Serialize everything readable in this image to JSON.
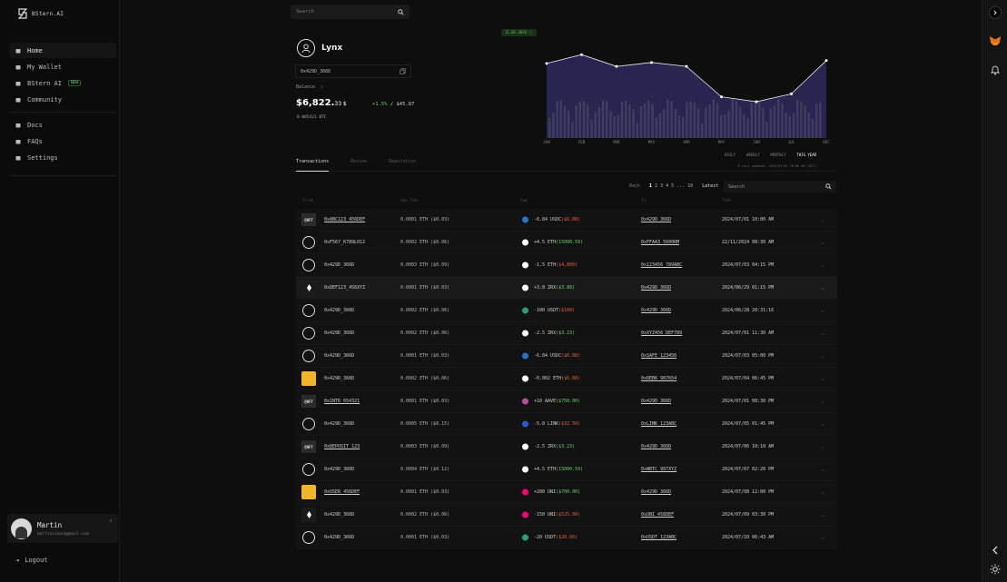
{
  "brand": {
    "name": "BStern.AI"
  },
  "nav": [
    {
      "label": "Home",
      "icon": "home-icon",
      "active": true
    },
    {
      "label": "My Wallet",
      "icon": "wallet-icon"
    },
    {
      "label": "BStern AI",
      "icon": "ai-icon",
      "badge": "NEW"
    },
    {
      "label": "Community",
      "icon": "community-icon"
    }
  ],
  "nav2": [
    {
      "label": "Docs",
      "icon": "folder-icon"
    },
    {
      "label": "FAQs",
      "icon": "faq-icon"
    },
    {
      "label": "Settings",
      "icon": "gear-icon"
    }
  ],
  "user": {
    "name": "Martin",
    "email": "martinsimon@gmail.com"
  },
  "logout": "Logout",
  "search": {
    "placeholder": "Search"
  },
  "profile": {
    "name": "Lynx",
    "address": "0x429D_366D",
    "balance_label": "Balance",
    "balance_main": "$6,822.",
    "balance_cents": "33 $",
    "change_pct": "+1.5%",
    "change_sep": " / ",
    "change_usd": "$45.87",
    "btc": "0.005421 BTC"
  },
  "chart_data": {
    "type": "area",
    "tooltip": "11.01.2024",
    "categories": [
      "JAN",
      "FEB",
      "MAR",
      "MAY",
      "APR",
      "MAY",
      "JUN",
      "JUL",
      "DEC"
    ],
    "values": [
      76,
      85,
      73,
      77,
      73,
      42,
      37,
      45,
      79
    ],
    "ylim": [
      0,
      100
    ],
    "periods": [
      "DAILY",
      "WEEKLY",
      "MONTHLY",
      "THIS YEAR"
    ],
    "active_period": "THIS YEAR",
    "last_update": "Last updated: 2024/07/01 10:00 AM (UTC)"
  },
  "tabs": [
    "Transactions",
    "Review",
    "Reputation"
  ],
  "pager": {
    "back": "Back",
    "p1": "1",
    "rest": "2 3 4 5 ... 10",
    "latest": "Latest"
  },
  "table_search": {
    "placeholder": "Search"
  },
  "columns": {
    "from": "From",
    "fee": "Gas Fee",
    "sum": "Sum",
    "to": "To",
    "time": "Time"
  },
  "transactions": [
    {
      "icon": "nft",
      "iconText": "@NFT",
      "from": "0xABC123_456DEF",
      "fromUnderline": true,
      "fee": "0.0001 ETH ($0.03)",
      "coin": "#2775ca",
      "amt": "-6.84 USDC",
      "amtVal": "($6.88)",
      "sign": "neg",
      "to": "0x429D_366D",
      "time": "2024/07/01 10:00 AM"
    },
    {
      "icon": "user",
      "from": "0xF567_K789L012",
      "fee": "0.0002 ETH ($0.06)",
      "coin": "#ffffff",
      "amt": "+4.5 ETH",
      "amtVal": "(15000.59)",
      "sign": "pos",
      "to": "0xFFAA3_5600RM",
      "time": "22/11/2024 08:30 AM"
    },
    {
      "icon": "user",
      "from": "0x429D_366D",
      "fee": "0.0003 ETH ($0.09)",
      "coin": "#ffffff",
      "amt": "-1.5 ETH",
      "amtVal": "($4,800)",
      "sign": "neg",
      "to": "0x123456_789ABC",
      "time": "2024/07/03 04:15 PM"
    },
    {
      "icon": "tok",
      "from": "0xDEF123_456XYZ",
      "fee": "0.0001 ETH ($0.03)",
      "coin": "#ffffff",
      "amt": "+3.0 ZRX",
      "amtVal": "($3.88)",
      "sign": "pos",
      "to": "0x429D_366D",
      "time": "2024/06/29 01:15 PM",
      "highlight": true
    },
    {
      "icon": "user",
      "from": "0x429D_366D",
      "fee": "0.0002 ETH ($0.06)",
      "coin": "#26a17b",
      "amt": "-100 USDT",
      "amtVal": "($100)",
      "sign": "neg",
      "to": "0x429D_366D",
      "time": "2024/06/28 20:31:16"
    },
    {
      "icon": "user",
      "from": "0x429D_366D",
      "fromUnderline": false,
      "fee": "0.0002 ETH ($0.06)",
      "coin": "#ffffff",
      "amt": "-2.5 ZRX",
      "amtVal": "($3.23)",
      "sign": "pos",
      "to": "0xXYZ456_DEF789",
      "time": "2024/07/01 11:30 AM"
    },
    {
      "icon": "user",
      "from": "0x429D_366D",
      "fee": "0.0001 ETH ($0.03)",
      "coin": "#2775ca",
      "amt": "-6.84 USDC",
      "amtVal": "($6.88)",
      "sign": "neg",
      "to": "0xSAFE_123456",
      "time": "2024/07/03 05:00 PM"
    },
    {
      "icon": "ape",
      "from": "0x429D_366D",
      "fee": "0.0002 ETH ($0.06)",
      "coin": "#ffffff",
      "amt": "-0.002 ETH",
      "amtVal": "($6.88)",
      "sign": "neg",
      "to": "0xDEB6_987654",
      "time": "2024/07/04 06:45 PM"
    },
    {
      "icon": "nft",
      "iconText": "@NFT",
      "from": "0x1NTR_654321",
      "fromUnderline": true,
      "fee": "0.0001 ETH ($0.03)",
      "coin": "#b6509e",
      "amt": "+10 AAVE",
      "amtVal": "($750.00)",
      "sign": "pos",
      "to": "0x429D_366D",
      "time": "2024/07/01 08:30 PM"
    },
    {
      "icon": "user",
      "from": "0x429D_366D",
      "fee": "0.0005 ETH ($0.15)",
      "coin": "#2a5ada",
      "amt": "-5.0 LINK",
      "amtVal": "($32.50)",
      "sign": "neg",
      "to": "0xLINK_123ABC",
      "time": "2024/07/05 01:45 PM"
    },
    {
      "icon": "nft",
      "iconText": "@NFT",
      "from": "0xDEPOSIT_123",
      "fromUnderline": true,
      "fee": "0.0003 ETH ($0.09)",
      "coin": "#ffffff",
      "amt": "-2.5 ZRX",
      "amtVal": "($3.23)",
      "sign": "pos",
      "to": "0x429D_366D",
      "time": "2024/07/06 10:10 AM"
    },
    {
      "icon": "user",
      "from": "0x429D_366D",
      "fee": "0.0004 ETH ($0.12)",
      "coin": "#ffffff",
      "amt": "+4.5 ETH",
      "amtVal": "(15000.59)",
      "sign": "pos",
      "to": "0xWBTC_987XYZ",
      "time": "2024/07/07 02:20 PM"
    },
    {
      "icon": "ape",
      "from": "0xUSER_456DEF",
      "fromUnderline": true,
      "fee": "0.0001 ETH ($0.03)",
      "coin": "#ff007a",
      "amt": "+200 UNI",
      "amtVal": "($700.00)",
      "sign": "pos",
      "to": "0x429D_366D",
      "time": "2024/07/08 12:00 PM"
    },
    {
      "icon": "tok",
      "from": "0x429D_366D",
      "fee": "0.0002 ETH ($0.06)",
      "coin": "#ff007a",
      "amt": "-150 UNI",
      "amtVal": "($525.00)",
      "sign": "neg",
      "to": "0xUNI_456DEF",
      "time": "2024/07/09 03:30 PM"
    },
    {
      "icon": "user",
      "from": "0x429D_366D",
      "fee": "0.0001 ETH ($0.03)",
      "coin": "#26a17b",
      "amt": "-20 USDT",
      "amtVal": "($20.00)",
      "sign": "neg",
      "to": "0xUSDT_123ABC",
      "time": "2024/07/10 06:43 AM"
    }
  ]
}
